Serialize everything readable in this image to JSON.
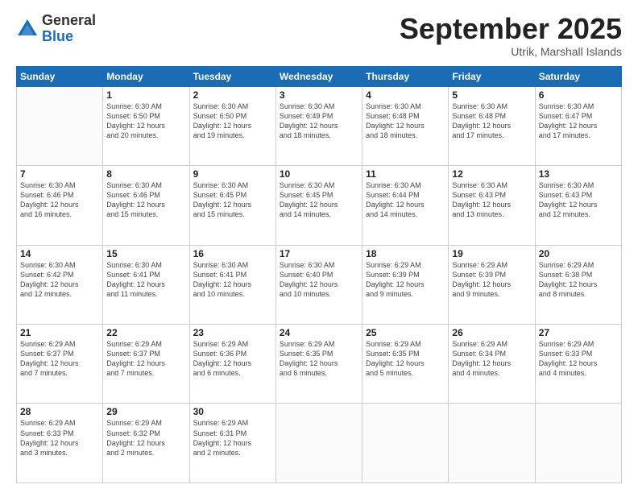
{
  "logo": {
    "general": "General",
    "blue": "Blue"
  },
  "header": {
    "month": "September 2025",
    "location": "Utrik, Marshall Islands"
  },
  "days_of_week": [
    "Sunday",
    "Monday",
    "Tuesday",
    "Wednesday",
    "Thursday",
    "Friday",
    "Saturday"
  ],
  "weeks": [
    [
      {
        "day": "",
        "info": ""
      },
      {
        "day": "1",
        "info": "Sunrise: 6:30 AM\nSunset: 6:50 PM\nDaylight: 12 hours\nand 20 minutes."
      },
      {
        "day": "2",
        "info": "Sunrise: 6:30 AM\nSunset: 6:50 PM\nDaylight: 12 hours\nand 19 minutes."
      },
      {
        "day": "3",
        "info": "Sunrise: 6:30 AM\nSunset: 6:49 PM\nDaylight: 12 hours\nand 18 minutes."
      },
      {
        "day": "4",
        "info": "Sunrise: 6:30 AM\nSunset: 6:48 PM\nDaylight: 12 hours\nand 18 minutes."
      },
      {
        "day": "5",
        "info": "Sunrise: 6:30 AM\nSunset: 6:48 PM\nDaylight: 12 hours\nand 17 minutes."
      },
      {
        "day": "6",
        "info": "Sunrise: 6:30 AM\nSunset: 6:47 PM\nDaylight: 12 hours\nand 17 minutes."
      }
    ],
    [
      {
        "day": "7",
        "info": "Sunrise: 6:30 AM\nSunset: 6:46 PM\nDaylight: 12 hours\nand 16 minutes."
      },
      {
        "day": "8",
        "info": "Sunrise: 6:30 AM\nSunset: 6:46 PM\nDaylight: 12 hours\nand 15 minutes."
      },
      {
        "day": "9",
        "info": "Sunrise: 6:30 AM\nSunset: 6:45 PM\nDaylight: 12 hours\nand 15 minutes."
      },
      {
        "day": "10",
        "info": "Sunrise: 6:30 AM\nSunset: 6:45 PM\nDaylight: 12 hours\nand 14 minutes."
      },
      {
        "day": "11",
        "info": "Sunrise: 6:30 AM\nSunset: 6:44 PM\nDaylight: 12 hours\nand 14 minutes."
      },
      {
        "day": "12",
        "info": "Sunrise: 6:30 AM\nSunset: 6:43 PM\nDaylight: 12 hours\nand 13 minutes."
      },
      {
        "day": "13",
        "info": "Sunrise: 6:30 AM\nSunset: 6:43 PM\nDaylight: 12 hours\nand 12 minutes."
      }
    ],
    [
      {
        "day": "14",
        "info": "Sunrise: 6:30 AM\nSunset: 6:42 PM\nDaylight: 12 hours\nand 12 minutes."
      },
      {
        "day": "15",
        "info": "Sunrise: 6:30 AM\nSunset: 6:41 PM\nDaylight: 12 hours\nand 11 minutes."
      },
      {
        "day": "16",
        "info": "Sunrise: 6:30 AM\nSunset: 6:41 PM\nDaylight: 12 hours\nand 10 minutes."
      },
      {
        "day": "17",
        "info": "Sunrise: 6:30 AM\nSunset: 6:40 PM\nDaylight: 12 hours\nand 10 minutes."
      },
      {
        "day": "18",
        "info": "Sunrise: 6:29 AM\nSunset: 6:39 PM\nDaylight: 12 hours\nand 9 minutes."
      },
      {
        "day": "19",
        "info": "Sunrise: 6:29 AM\nSunset: 6:39 PM\nDaylight: 12 hours\nand 9 minutes."
      },
      {
        "day": "20",
        "info": "Sunrise: 6:29 AM\nSunset: 6:38 PM\nDaylight: 12 hours\nand 8 minutes."
      }
    ],
    [
      {
        "day": "21",
        "info": "Sunrise: 6:29 AM\nSunset: 6:37 PM\nDaylight: 12 hours\nand 7 minutes."
      },
      {
        "day": "22",
        "info": "Sunrise: 6:29 AM\nSunset: 6:37 PM\nDaylight: 12 hours\nand 7 minutes."
      },
      {
        "day": "23",
        "info": "Sunrise: 6:29 AM\nSunset: 6:36 PM\nDaylight: 12 hours\nand 6 minutes."
      },
      {
        "day": "24",
        "info": "Sunrise: 6:29 AM\nSunset: 6:35 PM\nDaylight: 12 hours\nand 6 minutes."
      },
      {
        "day": "25",
        "info": "Sunrise: 6:29 AM\nSunset: 6:35 PM\nDaylight: 12 hours\nand 5 minutes."
      },
      {
        "day": "26",
        "info": "Sunrise: 6:29 AM\nSunset: 6:34 PM\nDaylight: 12 hours\nand 4 minutes."
      },
      {
        "day": "27",
        "info": "Sunrise: 6:29 AM\nSunset: 6:33 PM\nDaylight: 12 hours\nand 4 minutes."
      }
    ],
    [
      {
        "day": "28",
        "info": "Sunrise: 6:29 AM\nSunset: 6:33 PM\nDaylight: 12 hours\nand 3 minutes."
      },
      {
        "day": "29",
        "info": "Sunrise: 6:29 AM\nSunset: 6:32 PM\nDaylight: 12 hours\nand 2 minutes."
      },
      {
        "day": "30",
        "info": "Sunrise: 6:29 AM\nSunset: 6:31 PM\nDaylight: 12 hours\nand 2 minutes."
      },
      {
        "day": "",
        "info": ""
      },
      {
        "day": "",
        "info": ""
      },
      {
        "day": "",
        "info": ""
      },
      {
        "day": "",
        "info": ""
      }
    ]
  ]
}
